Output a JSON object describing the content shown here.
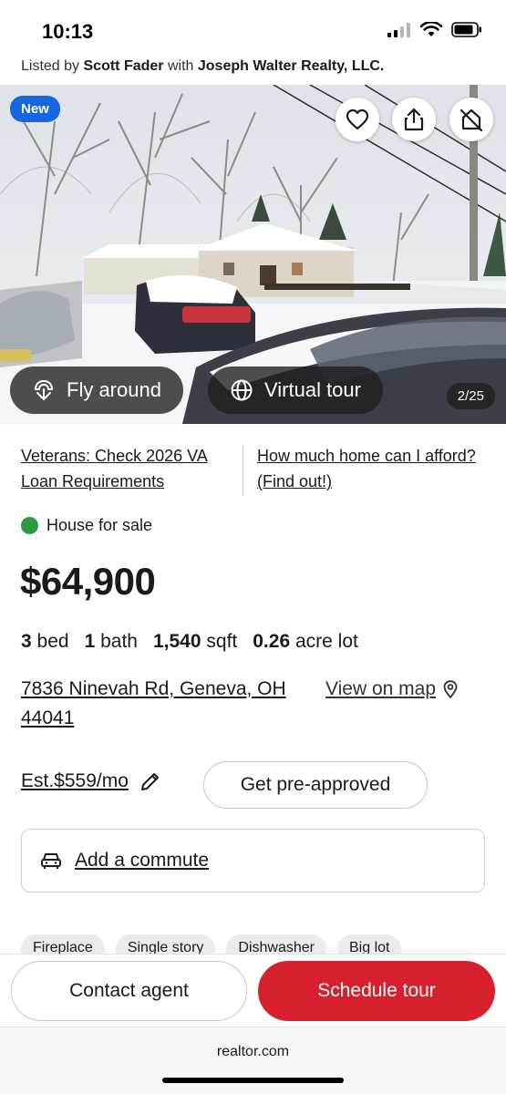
{
  "status_bar": {
    "time": "10:13",
    "icons": [
      "cellular-signal-icon",
      "wifi-icon",
      "battery-icon"
    ]
  },
  "listing_agent": {
    "prefix": "Listed by",
    "agent": "Scott Fader",
    "connector": "with",
    "brokerage": "Joseph Walter Realty, LLC."
  },
  "hero": {
    "badge": "New",
    "actions": [
      "heart-icon",
      "share-icon",
      "hide-listing-icon"
    ],
    "fly_around": "Fly around",
    "virtual_tour": "Virtual tour",
    "photo_counter": "2/25"
  },
  "promos": {
    "left": "Veterans: Check 2026 VA Loan Requirements",
    "right": "How much home can I afford? (Find out!)"
  },
  "listing": {
    "status": "House for sale",
    "status_color": "#2c9a45",
    "price": "$64,900",
    "beds_value": "3",
    "beds_label": "bed",
    "baths_value": "1",
    "baths_label": "bath",
    "sqft_value": "1,540",
    "sqft_label": "sqft",
    "lot_value": "0.26",
    "lot_label": "acre lot",
    "address": "7836 Ninevah Rd, Geneva, OH 44041",
    "view_on_map": "View on map"
  },
  "payment": {
    "estimate": "Est.$559/mo",
    "preapproved": "Get pre-approved"
  },
  "commute": {
    "label": "Add a commute"
  },
  "tags": [
    "Fireplace",
    "Single story",
    "Dishwasher",
    "Big lot"
  ],
  "bottom_bar": {
    "contact": "Contact agent",
    "schedule": "Schedule tour",
    "accent": "#d6202e"
  },
  "browser": {
    "url": "realtor.com"
  }
}
